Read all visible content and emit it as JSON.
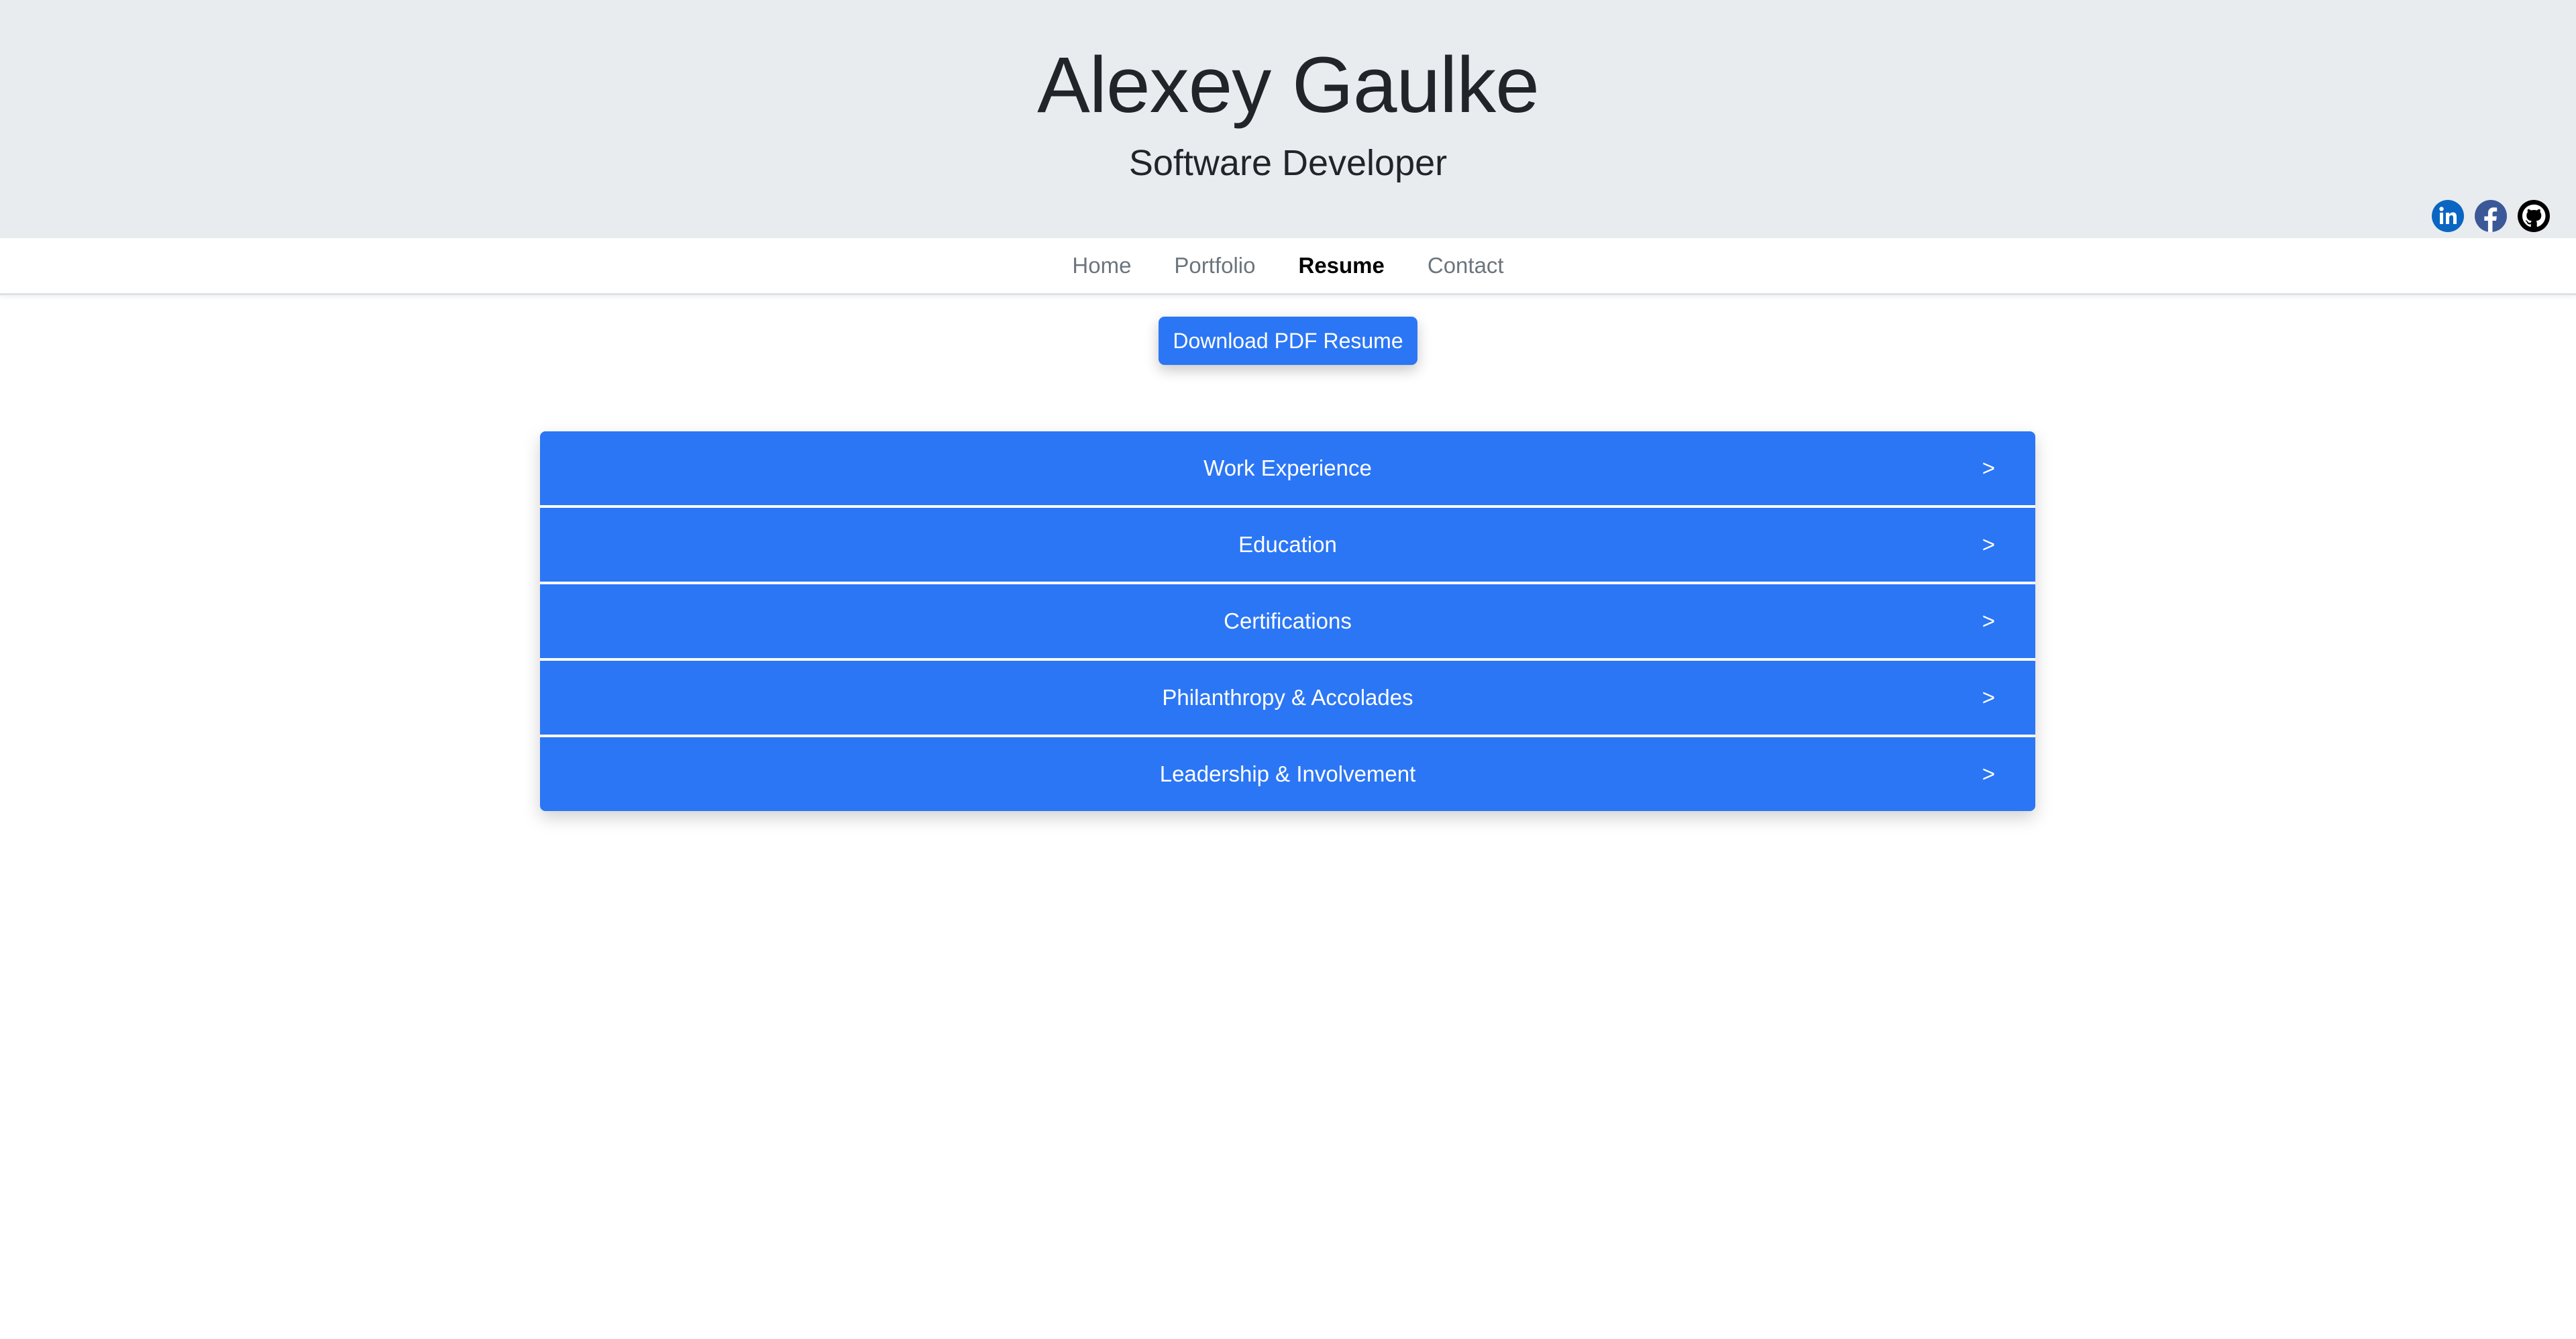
{
  "header": {
    "name": "Alexey Gaulke",
    "subtitle": "Software Developer",
    "social": [
      {
        "icon": "linkedin-icon",
        "color": "#0a66c2"
      },
      {
        "icon": "facebook-icon",
        "color": "#3b5998"
      },
      {
        "icon": "github-icon",
        "color": "#000000"
      }
    ]
  },
  "nav": {
    "items": [
      {
        "label": "Home",
        "active": false
      },
      {
        "label": "Portfolio",
        "active": false
      },
      {
        "label": "Resume",
        "active": true
      },
      {
        "label": "Contact",
        "active": false
      }
    ]
  },
  "resume": {
    "download_label": "Download PDF Resume",
    "sections": [
      {
        "label": "Work Experience",
        "chevron": ">"
      },
      {
        "label": "Education",
        "chevron": ">"
      },
      {
        "label": "Certifications",
        "chevron": ">"
      },
      {
        "label": "Philanthropy & Accolades",
        "chevron": ">"
      },
      {
        "label": "Leadership & Involvement",
        "chevron": ">"
      }
    ]
  },
  "colors": {
    "accent": "#2b76f5",
    "header_bg": "#e9ecef"
  }
}
